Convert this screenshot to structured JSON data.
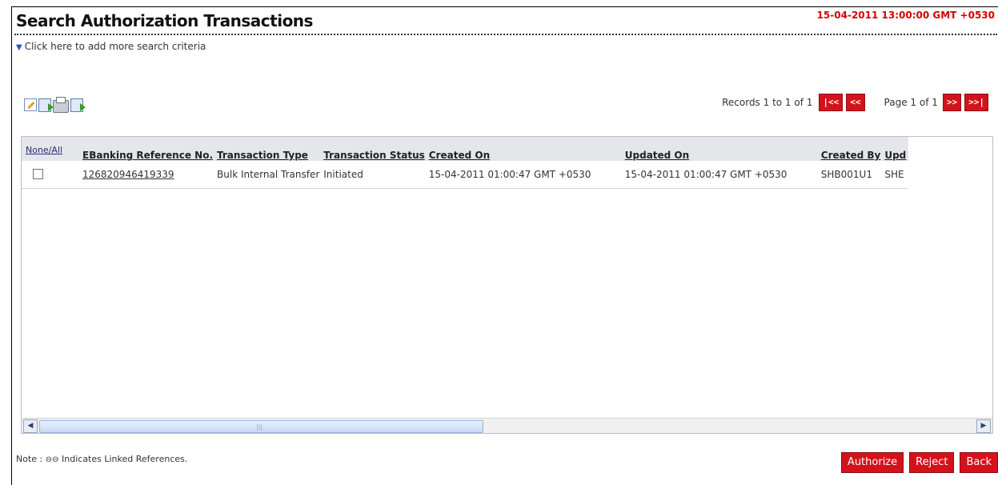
{
  "header": {
    "title": "Search Authorization Transactions",
    "datetime": "15-04-2011 13:00:00 GMT +0530"
  },
  "search": {
    "more_criteria": "Click here to add more search criteria"
  },
  "toolbar": {
    "icons": [
      "edit-icon",
      "export-icon",
      "print-icon",
      "download-icon"
    ]
  },
  "pagination": {
    "records": "Records 1 to 1 of 1",
    "first": "|<<",
    "prev": "<<",
    "page": "Page 1 of 1",
    "next": ">>",
    "last": ">>|"
  },
  "table": {
    "headers": {
      "select": "None/All",
      "ref": "EBanking Reference No.",
      "type": "Transaction Type",
      "status": "Transaction Status",
      "created_on": "Created On",
      "updated_on": "Updated On",
      "created_by": "Created By",
      "updated_by": "Upd"
    },
    "rows": [
      {
        "ref": "126820946419339",
        "type": "Bulk Internal Transfer",
        "status": "Initiated",
        "created_on": "15-04-2011 01:00:47 GMT +0530",
        "updated_on": "15-04-2011 01:00:47 GMT +0530",
        "created_by": "SHB001U1",
        "updated_by": "SHE"
      }
    ]
  },
  "note": {
    "prefix": "Note :",
    "text": "Indicates Linked References."
  },
  "actions": {
    "authorize": "Authorize",
    "reject": "Reject",
    "back": "Back"
  }
}
